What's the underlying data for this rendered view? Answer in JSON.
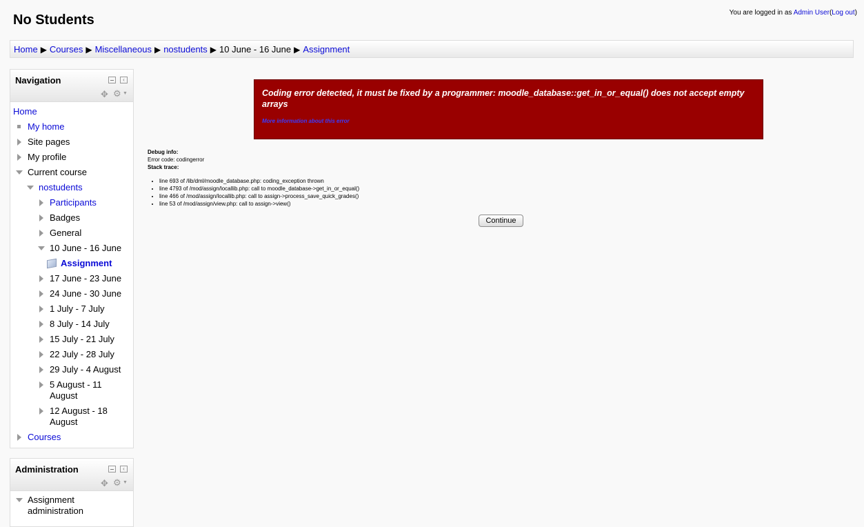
{
  "header": {
    "title": "No Students",
    "login_prefix": "You are logged in as",
    "user_name": "Admin User",
    "logout_label": "Log out",
    "paren_open": "(",
    "paren_close": ")"
  },
  "breadcrumb": {
    "separator": "▶",
    "items": [
      "Home",
      "Courses",
      "Miscellaneous",
      "nostudents",
      "10 June - 16 June",
      "Assignment"
    ]
  },
  "navigation": {
    "title": "Navigation",
    "home": "Home",
    "my_home": "My home",
    "site_pages": "Site pages",
    "my_profile": "My profile",
    "current_course": "Current course",
    "course": "nostudents",
    "participants": "Participants",
    "badges": "Badges",
    "general": "General",
    "week_current": "10 June - 16 June",
    "assignment": "Assignment",
    "weeks": [
      "17 June - 23 June",
      "24 June - 30 June",
      "1 July - 7 July",
      "8 July - 14 July",
      "15 July - 21 July",
      "22 July - 28 July",
      "29 July - 4 August"
    ],
    "week_aug5": [
      "5 August - 11",
      "August"
    ],
    "week_aug12": [
      "12 August - 18",
      "August"
    ],
    "courses": "Courses"
  },
  "administration": {
    "title": "Administration",
    "assignment_admin": [
      "Assignment",
      "administration"
    ]
  },
  "error": {
    "message": "Coding error detected, it must be fixed by a programmer: moodle_database::get_in_or_equal() does not accept empty arrays",
    "more_info": "More information about this error"
  },
  "debug": {
    "info_label": "Debug info:",
    "error_code": "Error code: codingerror",
    "stack_label": "Stack trace:",
    "trace": [
      "line 693 of /lib/dml/moodle_database.php: coding_exception thrown",
      "line 4793 of /mod/assign/locallib.php: call to moodle_database->get_in_or_equal()",
      "line 466 of /mod/assign/locallib.php: call to assign->process_save_quick_grades()",
      "line 53 of /mod/assign/view.php: call to assign->view()"
    ]
  },
  "continue_label": "Continue",
  "icons": {
    "move": "move-icon",
    "gear": "gear-icon",
    "minimize": "minimize-icon",
    "dock": "dock-icon"
  }
}
